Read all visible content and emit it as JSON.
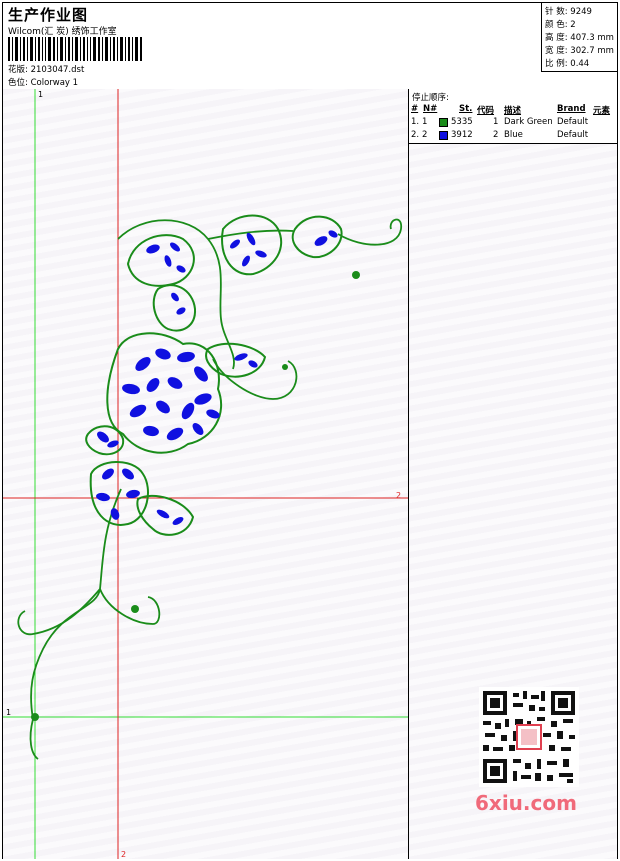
{
  "header": {
    "title": "生产作业图",
    "company": "Wilcom(汇 炭) 绣饰工作室",
    "pattern_label": "花版:",
    "pattern_value": "2103047.dst",
    "colorway_label": "色位:",
    "colorway_value": "Colorway 1"
  },
  "stats": {
    "stitches_label": "针 数:",
    "stitches_value": "9249",
    "colors_label": "颜 色:",
    "colors_value": "2",
    "height_label": "高 度:",
    "height_value": "407.3 mm",
    "width_label": "宽 度:",
    "width_value": "302.7 mm",
    "scale_label": "比 例:",
    "scale_value": "0.44"
  },
  "stop_sequence": {
    "title": "停止顺序:",
    "headers": [
      "#",
      "N#",
      "St.",
      "代码",
      "描述",
      "Brand",
      "元素"
    ],
    "rows": [
      {
        "index": "1.",
        "needle": "1",
        "stitches": "5335",
        "code": "1",
        "description": "Dark Green",
        "brand": "Default",
        "color": "#1a8c1a"
      },
      {
        "index": "2.",
        "needle": "2",
        "stitches": "3912",
        "code": "2",
        "description": "Blue",
        "brand": "Default",
        "color": "#1010e0"
      }
    ]
  },
  "guides": {
    "green_top": "1",
    "green_left": "1",
    "red_right": "2",
    "red_bottom": "2"
  },
  "watermark": {
    "text": "6xiu.com"
  },
  "colors": {
    "thread_green": "#1a8c1a",
    "thread_blue": "#1010e0",
    "guide_green": "#33dd33",
    "guide_red": "#dd2222"
  }
}
